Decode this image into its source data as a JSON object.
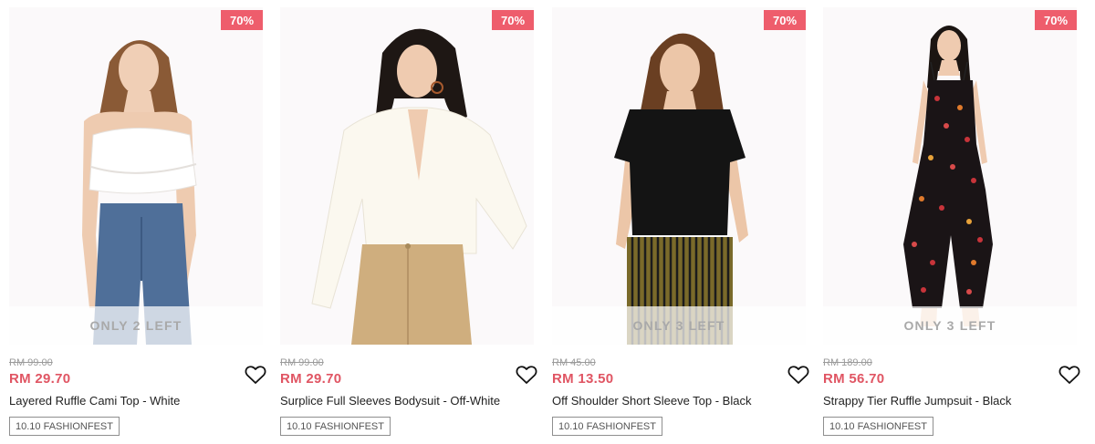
{
  "products": [
    {
      "discount": "70%",
      "stock": "ONLY 2 LEFT",
      "old_price": "RM 99.00",
      "new_price": "RM 29.70",
      "name": "Layered Ruffle Cami Top - White",
      "tag": "10.10 FASHIONFEST"
    },
    {
      "discount": "70%",
      "stock": "",
      "old_price": "RM 99.00",
      "new_price": "RM 29.70",
      "name": "Surplice Full Sleeves Bodysuit - Off-White",
      "tag": "10.10 FASHIONFEST"
    },
    {
      "discount": "70%",
      "stock": "ONLY 3 LEFT",
      "old_price": "RM 45.00",
      "new_price": "RM 13.50",
      "name": "Off Shoulder Short Sleeve Top - Black",
      "tag": "10.10 FASHIONFEST"
    },
    {
      "discount": "70%",
      "stock": "ONLY 3 LEFT",
      "old_price": "RM 189.00",
      "new_price": "RM 56.70",
      "name": "Strappy Tier Ruffle Jumpsuit - Black",
      "tag": "10.10 FASHIONFEST"
    }
  ],
  "colors": {
    "badge": "#ee5d6c",
    "sale_price": "#e05563",
    "image_bg": "#fbf9fa"
  },
  "icons": {
    "wishlist": "heart-outline-icon"
  }
}
